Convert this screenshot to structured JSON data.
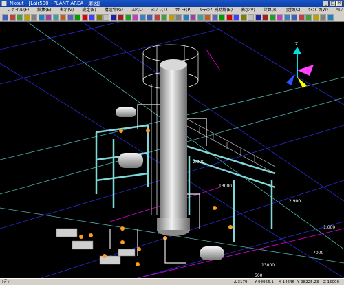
{
  "window": {
    "title": "Nkout - [Lair500 - PLANT AREA - 扉図]"
  },
  "menu": [
    "ファイル(F)",
    "編集(E)",
    "表示(V)",
    "設定(S)",
    "構造物(G)",
    "ﾌﾛｱ(L)",
    "ﾃﾝﾌﾟﾚ(T)",
    "ｻﾎﾟｰﾄ(P)",
    "ﾙｰﾃｨﾝｸﾞ補助線(B)",
    "表示(V)",
    "計算(R)",
    "変換(C)",
    "ｳｲﾝﾄﾞｳ(W)",
    "ﾍﾙﾌﾟ(H)"
  ],
  "viewport": {
    "labels": [
      "13000",
      "2.900",
      "1.000",
      "13000",
      "7000",
      "2.900",
      "500"
    ],
    "axis_label": "Z"
  },
  "status": {
    "left": "ﾚﾃﾞｨ",
    "coords": [
      "Δ 3179",
      "Y 98956.1",
      "X 14646",
      "Y 98225.23",
      "Z 15000"
    ]
  },
  "colors": {
    "pipe_cyan": "#7fd7d7",
    "grid_blue": "#2a2ad0",
    "magenta": "#e000e0",
    "orange": "#ff9a20",
    "white": "#ffffff"
  }
}
